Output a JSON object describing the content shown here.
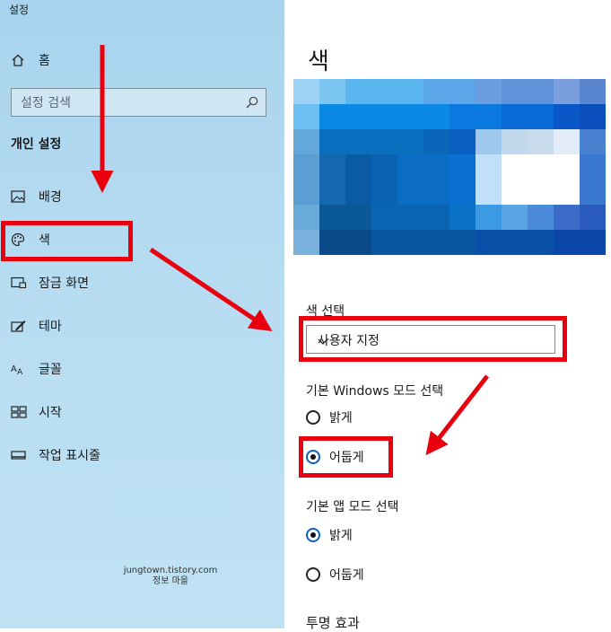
{
  "window": {
    "title": "설정"
  },
  "sidebar": {
    "home_label": "홈",
    "search_placeholder": "설정 검색",
    "section_title": "개인 설정",
    "items": [
      {
        "label": "배경",
        "icon": "picture-icon"
      },
      {
        "label": "색",
        "icon": "palette-icon"
      },
      {
        "label": "잠금 화면",
        "icon": "lock-screen-icon"
      },
      {
        "label": "테마",
        "icon": "theme-icon"
      },
      {
        "label": "글꼴",
        "icon": "font-icon"
      },
      {
        "label": "시작",
        "icon": "start-icon"
      },
      {
        "label": "작업 표시줄",
        "icon": "taskbar-icon"
      }
    ]
  },
  "watermark": {
    "line1": "jungtown.tistory.com",
    "line2": "정보 마을"
  },
  "main": {
    "title": "색",
    "color_choice": {
      "label": "색 선택",
      "value": "사용자 지정"
    },
    "windows_mode": {
      "label": "기본 Windows 모드 선택",
      "options": [
        "밝게",
        "어둡게"
      ],
      "selected": "어둡게"
    },
    "app_mode": {
      "label": "기본 앱 모드 선택",
      "options": [
        "밝게",
        "어둡게"
      ],
      "selected": "밝게"
    },
    "transparency": {
      "label": "투명 효과"
    }
  },
  "colors": {
    "accent": "#0078d7",
    "highlight": "#e8000e",
    "sidebar_bg": "#b8ddf2"
  }
}
